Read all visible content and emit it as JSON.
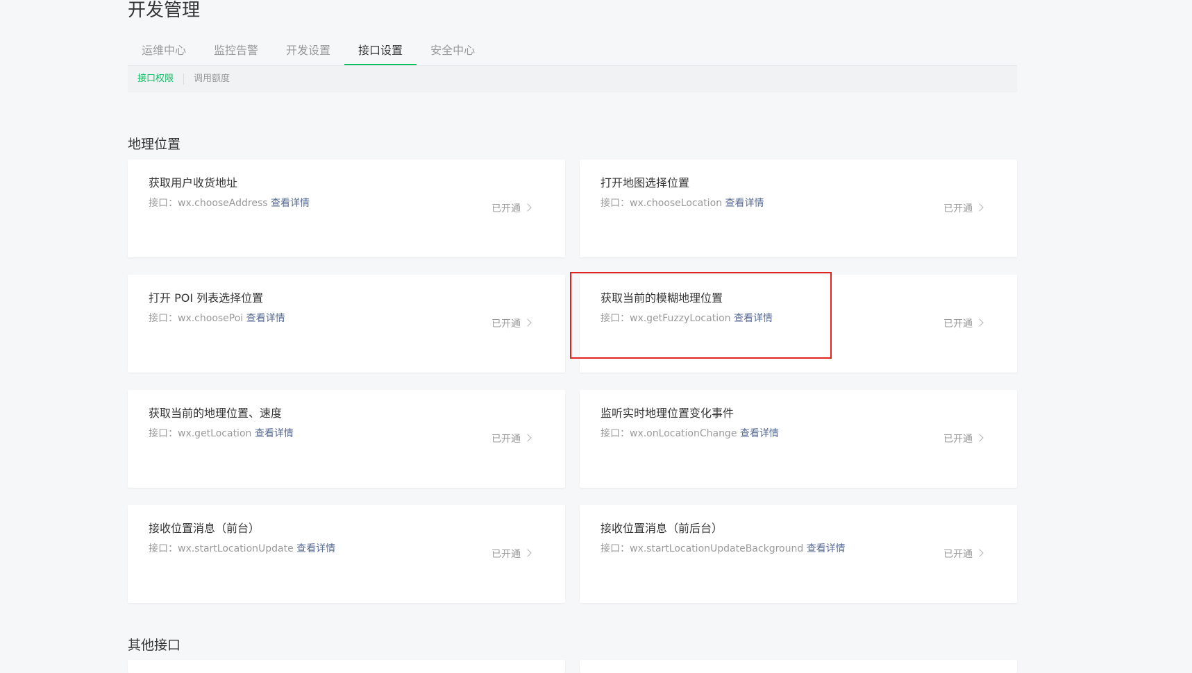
{
  "page": {
    "title": "开发管理"
  },
  "tabs": [
    {
      "label": "运维中心"
    },
    {
      "label": "监控告警"
    },
    {
      "label": "开发设置"
    },
    {
      "label": "接口设置",
      "active": true
    },
    {
      "label": "安全中心"
    }
  ],
  "subnav": [
    {
      "label": "接口权限",
      "active": true
    },
    {
      "label": "调用额度"
    }
  ],
  "sections": [
    {
      "title": "地理位置"
    },
    {
      "title": "其他接口"
    }
  ],
  "cards": [
    {
      "title": "获取用户收货地址",
      "api_prefix": "接口：wx.chooseAddress",
      "link": "查看详情",
      "status": "已开通"
    },
    {
      "title": "打开地图选择位置",
      "api_prefix": "接口：wx.chooseLocation",
      "link": "查看详情",
      "status": "已开通"
    },
    {
      "title": "打开 POI 列表选择位置",
      "api_prefix": "接口：wx.choosePoi",
      "link": "查看详情",
      "status": "已开通"
    },
    {
      "title": "获取当前的模糊地理位置",
      "api_prefix": "接口：wx.getFuzzyLocation",
      "link": "查看详情",
      "status": "已开通"
    },
    {
      "title": "获取当前的地理位置、速度",
      "api_prefix": "接口：wx.getLocation",
      "link": "查看详情",
      "status": "已开通"
    },
    {
      "title": "监听实时地理位置变化事件",
      "api_prefix": "接口：wx.onLocationChange",
      "link": "查看详情",
      "status": "已开通"
    },
    {
      "title": "接收位置消息（前台）",
      "api_prefix": "接口：wx.startLocationUpdate",
      "link": "查看详情",
      "status": "已开通"
    },
    {
      "title": "接收位置消息（前后台）",
      "api_prefix": "接口：wx.startLocationUpdateBackground",
      "link": "查看详情",
      "status": "已开通"
    }
  ],
  "colors": {
    "accent": "#07c160",
    "link": "#576b95",
    "highlight": "#e0231f"
  }
}
